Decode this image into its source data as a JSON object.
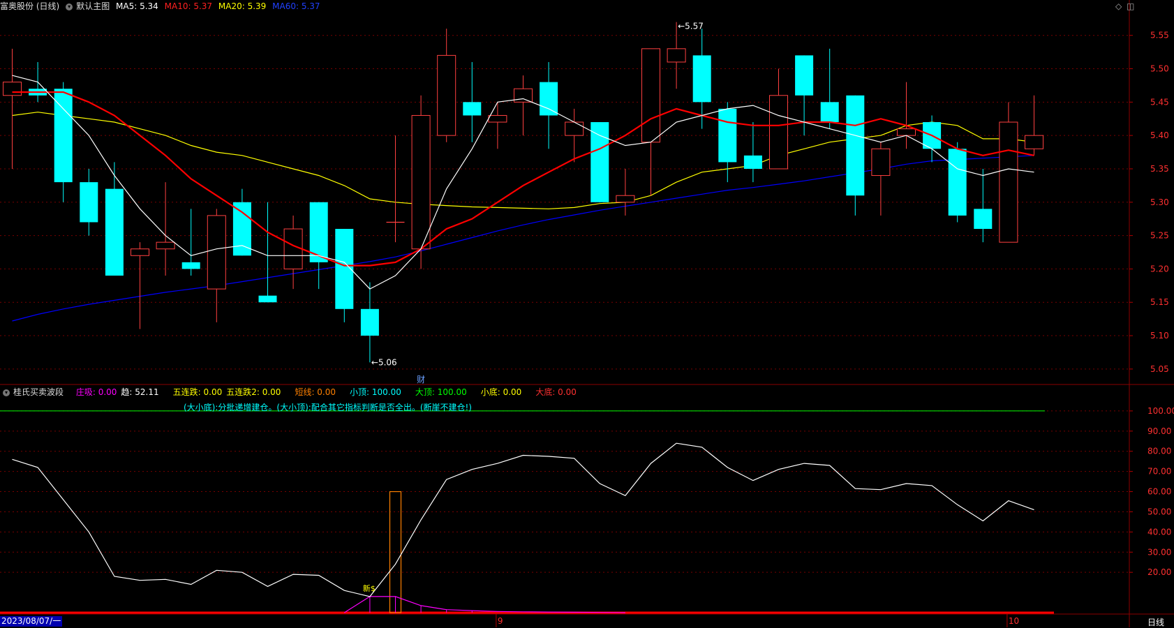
{
  "header": {
    "stock_name": "富奥股份 (日线)",
    "chart_name": "默认主图",
    "ma5": "MA5: 5.34",
    "ma10": "MA10: 5.37",
    "ma20": "MA20: 5.39",
    "ma60": "MA60: 5.37"
  },
  "indicator": {
    "name": "桂氏买卖波段",
    "items": [
      {
        "label": "庄吸: 0.00",
        "color": "#ff00ff"
      },
      {
        "label": "趋: 52.11",
        "color": "#ffffff"
      },
      {
        "label": "五连跌: 0.00",
        "color": "#ffff00"
      },
      {
        "label": "五连跌2: 0.00",
        "color": "#ffff00"
      },
      {
        "label": "短线: 0.00",
        "color": "#ff8000"
      },
      {
        "label": "小顶: 100.00",
        "color": "#00ffff"
      },
      {
        "label": "大顶: 100.00",
        "color": "#00ff00"
      },
      {
        "label": "小底: 0.00",
        "color": "#ffff00"
      },
      {
        "label": "大底: 0.00",
        "color": "#ff3030"
      }
    ],
    "note": "(大小底):分批递增建仓。(大小顶):配合其它指标判断是否全出。(断崖不建仓!)"
  },
  "footer": {
    "date": "2023/08/07/一",
    "period": "日线"
  },
  "chart_data": [
    {
      "type": "candlestick",
      "ylim": [
        5.03,
        5.58
      ],
      "yticks": [
        "5.55",
        "5.50",
        "5.45",
        "5.40",
        "5.35",
        "5.30",
        "5.25",
        "5.20",
        "5.15",
        "5.10",
        "5.05"
      ],
      "x_labels": [
        {
          "index": 19,
          "label": "9"
        },
        {
          "index": 39,
          "label": "10"
        }
      ],
      "annotations": [
        {
          "index": 26,
          "label": "5.57",
          "value": 5.57
        },
        {
          "index": 14,
          "label": "5.06",
          "value": 5.06
        },
        {
          "index": 16,
          "label": "财"
        }
      ],
      "colors": {
        "up": "#ff4040",
        "down": "#00ffff",
        "ma5": "#ffffff",
        "ma10": "#ff0000",
        "ma20": "#ffff00",
        "ma60": "#0000ff"
      },
      "candles": [
        {
          "o": 5.46,
          "h": 5.53,
          "l": 5.35,
          "c": 5.48
        },
        {
          "o": 5.47,
          "h": 5.51,
          "l": 5.45,
          "c": 5.46
        },
        {
          "o": 5.47,
          "h": 5.48,
          "l": 5.3,
          "c": 5.33
        },
        {
          "o": 5.33,
          "h": 5.35,
          "l": 5.25,
          "c": 5.27
        },
        {
          "o": 5.32,
          "h": 5.36,
          "l": 5.19,
          "c": 5.19
        },
        {
          "o": 5.22,
          "h": 5.24,
          "l": 5.11,
          "c": 5.23
        },
        {
          "o": 5.23,
          "h": 5.33,
          "l": 5.19,
          "c": 5.24
        },
        {
          "o": 5.21,
          "h": 5.29,
          "l": 5.19,
          "c": 5.2
        },
        {
          "o": 5.17,
          "h": 5.29,
          "l": 5.12,
          "c": 5.28
        },
        {
          "o": 5.3,
          "h": 5.32,
          "l": 5.22,
          "c": 5.22
        },
        {
          "o": 5.16,
          "h": 5.3,
          "l": 5.15,
          "c": 5.15
        },
        {
          "o": 5.2,
          "h": 5.28,
          "l": 5.17,
          "c": 5.26
        },
        {
          "o": 5.3,
          "h": 5.3,
          "l": 5.17,
          "c": 5.21
        },
        {
          "o": 5.26,
          "h": 5.26,
          "l": 5.12,
          "c": 5.14
        },
        {
          "o": 5.14,
          "h": 5.18,
          "l": 5.06,
          "c": 5.1
        },
        {
          "o": 5.27,
          "h": 5.4,
          "l": 5.24,
          "c": 5.27
        },
        {
          "o": 5.23,
          "h": 5.46,
          "l": 5.2,
          "c": 5.43
        },
        {
          "o": 5.4,
          "h": 5.56,
          "l": 5.39,
          "c": 5.52
        },
        {
          "o": 5.45,
          "h": 5.51,
          "l": 5.39,
          "c": 5.43
        },
        {
          "o": 5.42,
          "h": 5.45,
          "l": 5.38,
          "c": 5.43
        },
        {
          "o": 5.45,
          "h": 5.49,
          "l": 5.4,
          "c": 5.47
        },
        {
          "o": 5.48,
          "h": 5.51,
          "l": 5.38,
          "c": 5.43
        },
        {
          "o": 5.4,
          "h": 5.44,
          "l": 5.36,
          "c": 5.42
        },
        {
          "o": 5.42,
          "h": 5.42,
          "l": 5.3,
          "c": 5.3
        },
        {
          "o": 5.3,
          "h": 5.35,
          "l": 5.28,
          "c": 5.31
        },
        {
          "o": 5.39,
          "h": 5.53,
          "l": 5.31,
          "c": 5.53
        },
        {
          "o": 5.51,
          "h": 5.57,
          "l": 5.47,
          "c": 5.53
        },
        {
          "o": 5.52,
          "h": 5.56,
          "l": 5.41,
          "c": 5.45
        },
        {
          "o": 5.44,
          "h": 5.45,
          "l": 5.33,
          "c": 5.36
        },
        {
          "o": 5.37,
          "h": 5.42,
          "l": 5.33,
          "c": 5.35
        },
        {
          "o": 5.35,
          "h": 5.5,
          "l": 5.35,
          "c": 5.46
        },
        {
          "o": 5.52,
          "h": 5.52,
          "l": 5.4,
          "c": 5.46
        },
        {
          "o": 5.45,
          "h": 5.53,
          "l": 5.41,
          "c": 5.42
        },
        {
          "o": 5.46,
          "h": 5.46,
          "l": 5.28,
          "c": 5.31
        },
        {
          "o": 5.34,
          "h": 5.39,
          "l": 5.28,
          "c": 5.38
        },
        {
          "o": 5.4,
          "h": 5.48,
          "l": 5.38,
          "c": 5.41
        },
        {
          "o": 5.42,
          "h": 5.43,
          "l": 5.36,
          "c": 5.38
        },
        {
          "o": 5.38,
          "h": 5.39,
          "l": 5.27,
          "c": 5.28
        },
        {
          "o": 5.29,
          "h": 5.35,
          "l": 5.24,
          "c": 5.26
        },
        {
          "o": 5.24,
          "h": 5.45,
          "l": 5.24,
          "c": 5.42
        },
        {
          "o": 5.38,
          "h": 5.46,
          "l": 5.37,
          "c": 5.4
        }
      ],
      "ma5": [
        5.49,
        5.48,
        5.44,
        5.4,
        5.34,
        5.29,
        5.25,
        5.22,
        5.23,
        5.235,
        5.22,
        5.22,
        5.22,
        5.21,
        5.17,
        5.19,
        5.23,
        5.32,
        5.38,
        5.45,
        5.455,
        5.44,
        5.42,
        5.4,
        5.385,
        5.39,
        5.42,
        5.43,
        5.44,
        5.445,
        5.43,
        5.42,
        5.41,
        5.4,
        5.39,
        5.4,
        5.38,
        5.35,
        5.34,
        5.35,
        5.345
      ],
      "ma10": [
        5.465,
        5.465,
        5.465,
        5.45,
        5.43,
        5.4,
        5.37,
        5.335,
        5.31,
        5.285,
        5.255,
        5.235,
        5.22,
        5.205,
        5.205,
        5.21,
        5.23,
        5.26,
        5.275,
        5.3,
        5.325,
        5.345,
        5.365,
        5.38,
        5.4,
        5.425,
        5.44,
        5.43,
        5.42,
        5.415,
        5.415,
        5.42,
        5.42,
        5.415,
        5.425,
        5.415,
        5.4,
        5.38,
        5.37,
        5.378,
        5.37
      ],
      "ma20": [
        5.43,
        5.435,
        5.43,
        5.425,
        5.42,
        5.41,
        5.4,
        5.385,
        5.375,
        5.37,
        5.36,
        5.35,
        5.34,
        5.325,
        5.305,
        5.3,
        5.297,
        5.295,
        5.293,
        5.292,
        5.291,
        5.29,
        5.292,
        5.298,
        5.3,
        5.31,
        5.33,
        5.345,
        5.35,
        5.355,
        5.37,
        5.38,
        5.39,
        5.395,
        5.4,
        5.415,
        5.42,
        5.415,
        5.395,
        5.395,
        5.39
      ],
      "ma60": [
        5.122,
        5.132,
        5.14,
        5.147,
        5.153,
        5.159,
        5.165,
        5.17,
        5.175,
        5.181,
        5.187,
        5.193,
        5.199,
        5.205,
        5.211,
        5.218,
        5.227,
        5.237,
        5.247,
        5.257,
        5.266,
        5.274,
        5.281,
        5.288,
        5.294,
        5.3,
        5.306,
        5.312,
        5.318,
        5.322,
        5.327,
        5.332,
        5.338,
        5.344,
        5.35,
        5.357,
        5.362,
        5.364,
        5.366,
        5.368,
        5.37
      ]
    },
    {
      "type": "line",
      "ylim": [
        0,
        110
      ],
      "yticks": [
        "100.00",
        "90.00",
        "80.00",
        "70.00",
        "60.00",
        "50.00",
        "40.00",
        "30.00",
        "20.00"
      ],
      "series": [
        {
          "name": "趋",
          "color": "#ffffff",
          "values": [
            76,
            72,
            56,
            40,
            18,
            16,
            16.5,
            14,
            21,
            20,
            13,
            19,
            18.5,
            11,
            8,
            24,
            46,
            66,
            71,
            74,
            78,
            77.5,
            76.5,
            64,
            58,
            74,
            84,
            82,
            72,
            65.5,
            71,
            74,
            73,
            61.5,
            61,
            64,
            63,
            53.5,
            45.5,
            55.5,
            51
          ]
        },
        {
          "name": "大顶",
          "color": "#00ff00",
          "constant": 100
        },
        {
          "name": "底线",
          "color": "#ff0000",
          "constant": 0
        }
      ],
      "bars": [
        {
          "index": 15,
          "value": 60,
          "color": "#ff8000"
        }
      ],
      "magenta_hump": [
        0,
        0,
        0,
        0,
        0,
        0,
        0,
        0,
        0,
        0,
        0,
        0,
        0,
        0,
        8,
        8,
        3.5,
        1.5,
        1,
        0.6,
        0.4,
        0.3,
        0.2,
        0.1,
        0,
        0,
        0,
        0,
        0,
        0,
        0,
        0,
        0,
        0,
        0,
        0,
        0,
        0,
        0,
        0,
        0
      ],
      "marker": {
        "index": 14,
        "label": "新$",
        "value": 10
      }
    }
  ]
}
